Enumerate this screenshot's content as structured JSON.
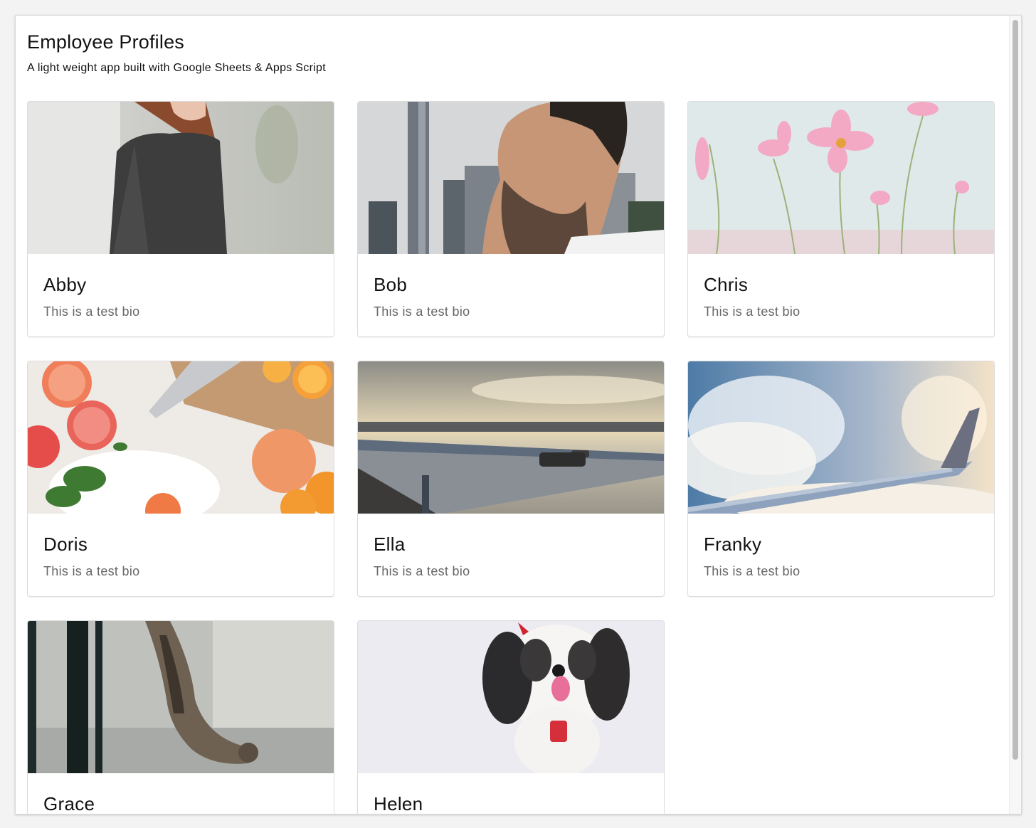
{
  "header": {
    "title": "Employee Profiles",
    "subtitle": "A light weight app built with Google Sheets & Apps Script"
  },
  "profiles": [
    {
      "name": "Abby",
      "bio": "This is a test bio",
      "image": "woman-in-grey-tshirt-photo"
    },
    {
      "name": "Bob",
      "bio": "This is a test bio",
      "image": "bearded-man-city-photo"
    },
    {
      "name": "Chris",
      "bio": "This is a test bio",
      "image": "pink-cosmos-flowers-photo"
    },
    {
      "name": "Doris",
      "bio": "This is a test bio",
      "image": "citrus-fruits-cutting-board-photo"
    },
    {
      "name": "Ella",
      "bio": "This is a test bio",
      "image": "car-on-coastal-bridge-photo"
    },
    {
      "name": "Franky",
      "bio": "This is a test bio",
      "image": "airplane-wing-clouds-photo"
    },
    {
      "name": "Grace",
      "bio": "",
      "image": "tabby-cat-climbing-photo"
    },
    {
      "name": "Helen",
      "bio": "",
      "image": "shih-tzu-dog-photo"
    }
  ]
}
